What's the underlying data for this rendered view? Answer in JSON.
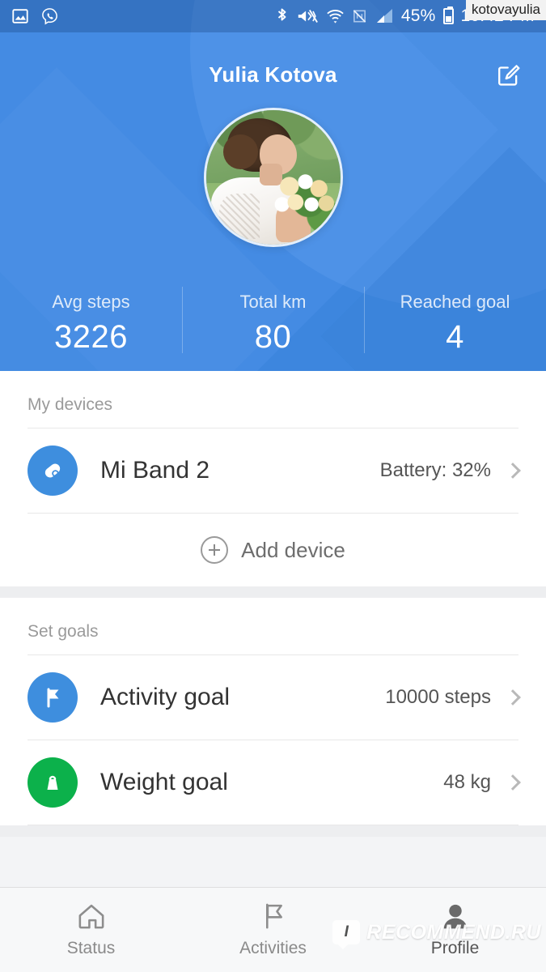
{
  "status_bar": {
    "icons_left": [
      "image-icon",
      "viber-icon"
    ],
    "icons_right": [
      "bluetooth-icon",
      "vibrate-icon",
      "wifi-icon",
      "nfc-off-icon",
      "signal-icon"
    ],
    "battery_percent": "45%",
    "time": "10:42 PM"
  },
  "watermarks": {
    "top_right": "kotovayulia",
    "bottom_badge": "I",
    "bottom_text": "RECOMMEND.RU"
  },
  "header": {
    "title": "Yulia Kotova",
    "edit_icon": "edit-pencil-icon",
    "avatar_alt": "bride-with-bouquet-photo",
    "stats": [
      {
        "label": "Avg steps",
        "value": "3226"
      },
      {
        "label": "Total km",
        "value": "80"
      },
      {
        "label": "Reached goal",
        "value": "4"
      }
    ]
  },
  "devices": {
    "section_title": "My devices",
    "items": [
      {
        "icon": "fitness-band-icon",
        "icon_color": "#3e8ede",
        "label": "Mi Band 2",
        "value": "Battery: 32%"
      }
    ],
    "add_label": "Add device",
    "add_icon": "plus-circle-icon"
  },
  "goals": {
    "section_title": "Set goals",
    "items": [
      {
        "icon": "flag-icon",
        "icon_color": "#3e8ede",
        "label": "Activity goal",
        "value": "10000 steps"
      },
      {
        "icon": "weight-icon",
        "icon_color": "#0cb14b",
        "label": "Weight goal",
        "value": "48 kg"
      }
    ]
  },
  "bottom_nav": {
    "items": [
      {
        "icon": "home-icon",
        "label": "Status",
        "active": false
      },
      {
        "icon": "flag-icon",
        "label": "Activities",
        "active": false
      },
      {
        "icon": "person-icon",
        "label": "Profile",
        "active": true
      }
    ]
  },
  "colors": {
    "header_blue": "#3d86de",
    "accent_blue": "#3e8ede",
    "accent_green": "#0cb14b",
    "nav_background": "#f7f8f9"
  }
}
